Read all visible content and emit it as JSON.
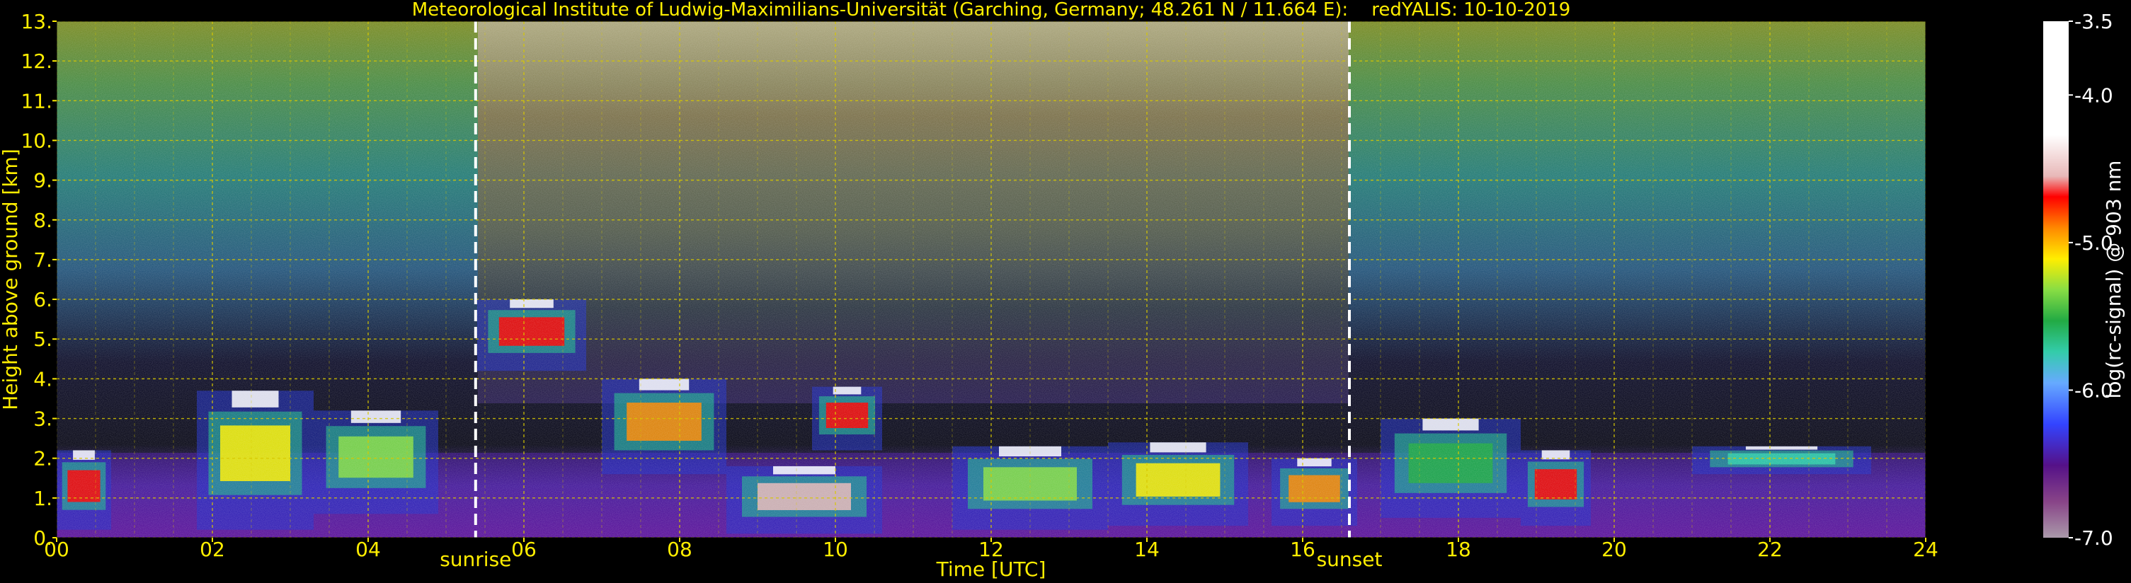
{
  "chart_data": {
    "type": "heatmap",
    "title": "Meteorological Institute of Ludwig-Maximilians-Universität (Garching, Germany; 48.261 N / 11.664 E):    redYALIS: 10-10-2019",
    "xlabel": "Time [UTC]",
    "ylabel": "Height above ground [km]",
    "xlim": [
      0,
      24
    ],
    "ylim": [
      0,
      13
    ],
    "x_ticks": [
      "00",
      "02",
      "04",
      "06",
      "08",
      "10",
      "12",
      "14",
      "16",
      "18",
      "20",
      "22",
      "24"
    ],
    "y_ticks": [
      "0.",
      "1.",
      "2.",
      "3.",
      "4.",
      "5.",
      "6.",
      "7.",
      "8.",
      "9.",
      "10.",
      "11.",
      "12.",
      "13."
    ],
    "grid": true,
    "markers": [
      {
        "label": "sunrise",
        "x": 5.38
      },
      {
        "label": "sunset",
        "x": 16.6
      }
    ],
    "colorbar": {
      "label": "log(rc-signal) @ 903 nm",
      "range": [
        -7.0,
        -3.5
      ],
      "ticks": [
        "-3.5",
        "-4.0",
        "-5.0",
        "-6.0",
        "-7.0"
      ]
    },
    "clouds": [
      {
        "x0": 0.0,
        "x1": 0.7,
        "y0": 0.2,
        "y1": 2.2,
        "v": -4.5
      },
      {
        "x0": 1.8,
        "x1": 3.3,
        "y0": 0.2,
        "y1": 3.7,
        "v": -4.9
      },
      {
        "x0": 3.3,
        "x1": 4.9,
        "y0": 0.6,
        "y1": 3.2,
        "v": -5.3
      },
      {
        "x0": 5.4,
        "x1": 6.8,
        "y0": 4.2,
        "y1": 6.0,
        "v": -4.6
      },
      {
        "x0": 7.0,
        "x1": 8.6,
        "y0": 1.6,
        "y1": 4.0,
        "v": -4.7
      },
      {
        "x0": 8.6,
        "x1": 10.6,
        "y0": 0.1,
        "y1": 1.8,
        "v": -4.4
      },
      {
        "x0": 9.7,
        "x1": 10.6,
        "y0": 2.2,
        "y1": 3.8,
        "v": -4.6
      },
      {
        "x0": 11.5,
        "x1": 13.5,
        "y0": 0.2,
        "y1": 2.3,
        "v": -5.2
      },
      {
        "x0": 13.5,
        "x1": 15.3,
        "y0": 0.3,
        "y1": 2.4,
        "v": -5.0
      },
      {
        "x0": 15.6,
        "x1": 16.7,
        "y0": 0.3,
        "y1": 2.0,
        "v": -4.7
      },
      {
        "x0": 17.0,
        "x1": 18.8,
        "y0": 0.5,
        "y1": 3.0,
        "v": -5.4
      },
      {
        "x0": 18.8,
        "x1": 19.7,
        "y0": 0.3,
        "y1": 2.2,
        "v": -4.6
      },
      {
        "x0": 21.0,
        "x1": 23.3,
        "y0": 1.6,
        "y1": 2.3,
        "v": -5.6
      }
    ]
  }
}
